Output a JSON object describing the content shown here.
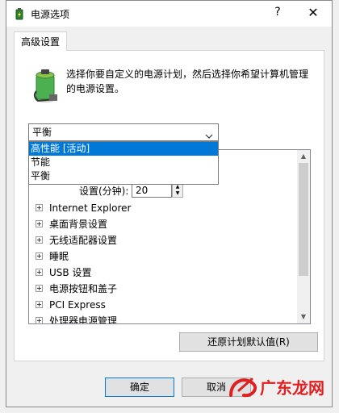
{
  "window": {
    "title": "电源选项",
    "help_label": "?",
    "close_label": "✕"
  },
  "tab": {
    "label": "高级设置"
  },
  "description": "选择你要自定义的电源计划，然后选择你希望计算机管理的电源设置。",
  "plan_select": {
    "value": "平衡",
    "options": [
      {
        "label": "高性能 [活动]"
      },
      {
        "label": "节能"
      },
      {
        "label": "平衡"
      }
    ]
  },
  "setting": {
    "label": "设置(分钟):",
    "value": "20"
  },
  "tree": [
    {
      "label": "Internet Explorer"
    },
    {
      "label": "桌面背景设置"
    },
    {
      "label": "无线适配器设置"
    },
    {
      "label": "睡眠"
    },
    {
      "label": "USB 设置"
    },
    {
      "label": "电源按钮和盖子"
    },
    {
      "label": "PCI Express"
    },
    {
      "label": "处理器电源管理"
    }
  ],
  "buttons": {
    "restore": "还原计划默认值(R)",
    "ok": "确定",
    "cancel": "取消"
  },
  "watermark": {
    "text": "广东龙网"
  },
  "icons": {
    "app": "battery-icon",
    "panel": "battery-plug-icon"
  },
  "colors": {
    "selection": "#0078d7",
    "watermark_red": "#e02020"
  }
}
